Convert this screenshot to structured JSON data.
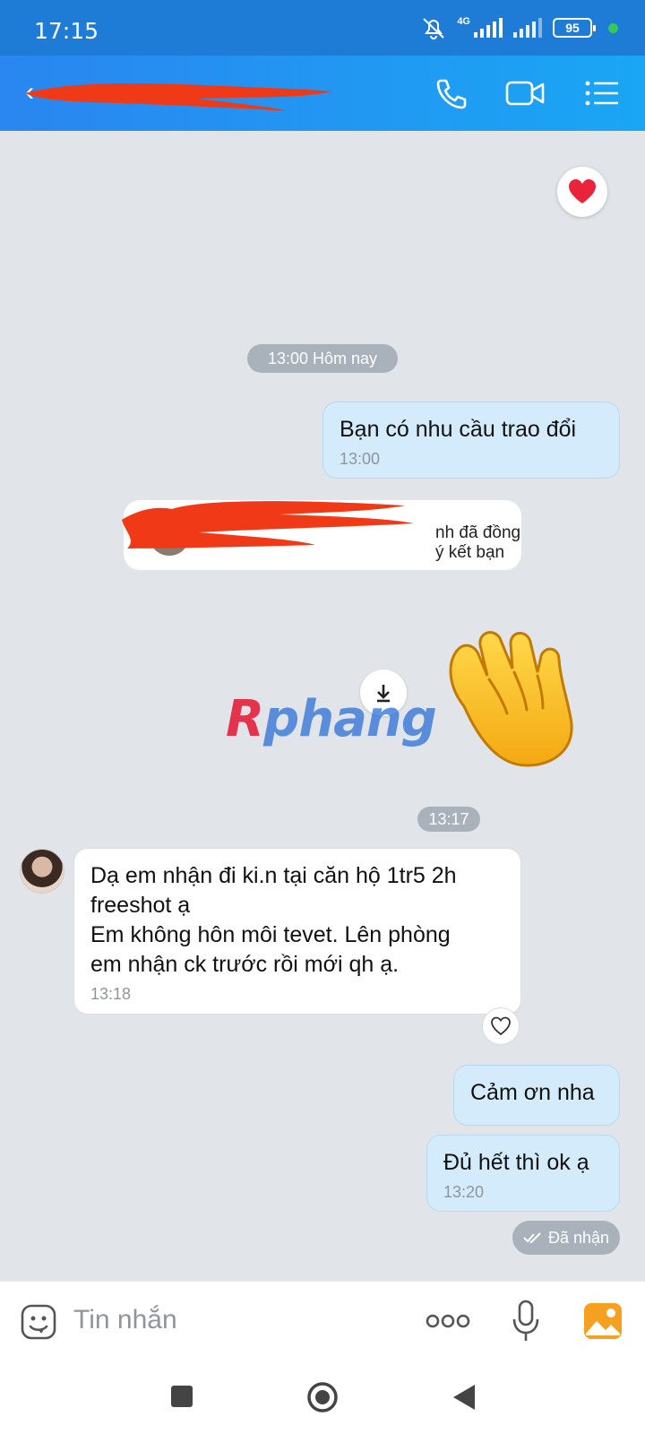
{
  "status_bar": {
    "time": "17:15",
    "network": "4G",
    "battery": "95"
  },
  "header": {
    "contact_name_redacted": "",
    "icons": [
      "phone-icon",
      "video-call-icon",
      "menu-icon"
    ]
  },
  "messages": {
    "timestamp_1": "13:00 Hôm nay",
    "out_1": {
      "text": "Bạn có nhu cầu trao đổi",
      "time": "13:00"
    },
    "notice": "nh đã đồng ý kết bạn",
    "watermark_r": "R",
    "watermark_rest": "phang",
    "timestamp_2": "13:17",
    "in_1": {
      "text": "Dạ em nhận đi ki.n tại căn hộ 1tr5 2h\nfreeshot ạ\nEm không hôn môi tevet. Lên phòng\nem nhận ck trước rồi mới qh ạ.",
      "time": "13:18"
    },
    "out_2": {
      "text": "Cảm ơn nha"
    },
    "out_3": {
      "text": "Đủ hết thì ok ạ",
      "time": "13:20"
    },
    "delivery_status": "Đã nhận"
  },
  "composer": {
    "placeholder": "Tin nhắn"
  },
  "colors": {
    "header": "#2a86f0",
    "out_bubble": "#d4ebfb",
    "in_bubble": "#ffffff",
    "chat_bg": "#e1e5ea",
    "redaction": "#f03a17"
  }
}
